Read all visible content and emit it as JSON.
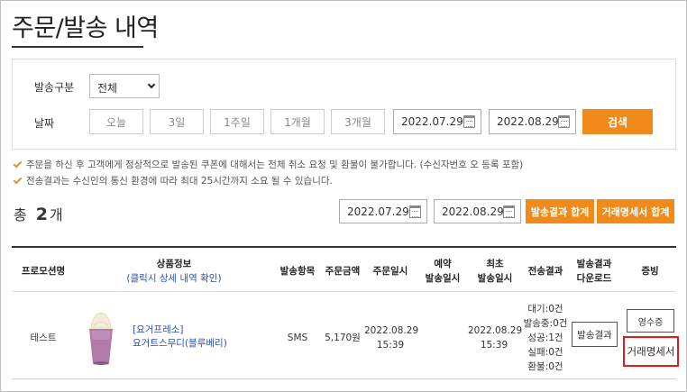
{
  "page": {
    "title": "주문/발송 내역"
  },
  "filter": {
    "type_label": "발송구분",
    "type_value": "전체",
    "date_label": "날짜",
    "periods": [
      "오늘",
      "3일",
      "1주일",
      "1개월",
      "3개월"
    ],
    "date_from": "2022.07.29",
    "date_to": "2022.08.29",
    "search_label": "검색"
  },
  "notices": [
    "주문을 하신 후 고객에게 정상적으로 발송된 쿠폰에 대해서는 전체 취소 요청 및 환불이 불가합니다. (수신자번호 오 등록 포함)",
    "전송결과는 수신인의 통신 환경에 따라 최대 25시간까지 소요 될 수 있습니다."
  ],
  "summary": {
    "total_prefix": "총",
    "total_count": "2",
    "total_suffix": "개",
    "date_from": "2022.07.29",
    "date_to": "2022.08.29",
    "send_total_label": "발송결과 합계",
    "invoice_total_label": "거래명세서 합계"
  },
  "table": {
    "headers": {
      "promo": "프로모션명",
      "product": "상품정보",
      "product_sub": "(클릭시 상세 내역 확인)",
      "send_item": "발송항목",
      "amount": "주문금액",
      "order_date": "주문일시",
      "reserve_1": "예약",
      "reserve_2": "발송일시",
      "first_1": "최초",
      "first_2": "발송일시",
      "result": "전송결과",
      "download_1": "발송결과",
      "download_2": "다운로드",
      "proof": "증빙"
    },
    "rows": [
      {
        "promo": "테스트",
        "product_brand": "[요거프레소]",
        "product_name": "요거트스무디(블루베리)",
        "send_item": "SMS",
        "amount": "5,170원",
        "order_date": "2022.08.29",
        "order_time": "15:39",
        "first_date": "2022.08.29",
        "first_time": "15:39",
        "result": [
          "대기:0건",
          "발송중:0건",
          "성공:1건",
          "실패:0건",
          "환불:0건"
        ],
        "download_label": "발송결과",
        "receipt_label": "영수증",
        "invoice_label": "거래명세서"
      }
    ]
  }
}
